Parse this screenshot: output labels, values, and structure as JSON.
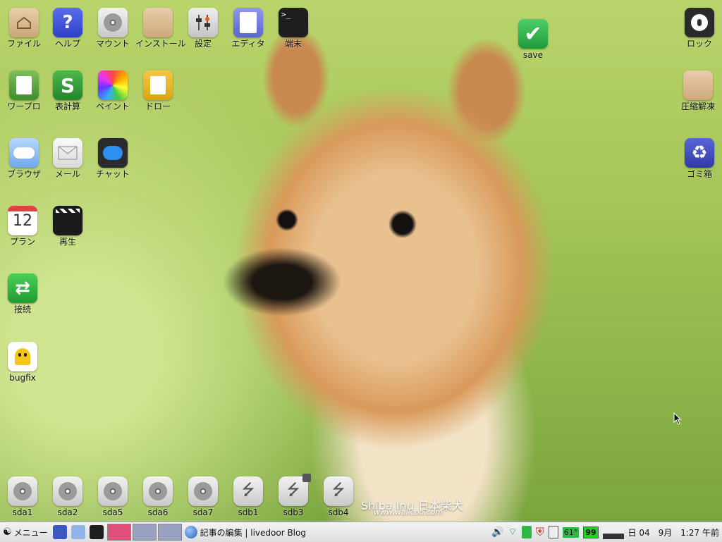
{
  "desktop": {
    "icons": {
      "file": "ファイル",
      "help": "ヘルプ",
      "mount": "マウント",
      "install": "インストール",
      "settings": "設定",
      "editor": "エディタ",
      "terminal": "端末",
      "save": "save",
      "lock": "ロック",
      "wordpro": "ワープロ",
      "spreadsheet": "表計算",
      "paint": "ペイント",
      "draw": "ドロー",
      "unzip": "圧縮解凍",
      "browser": "ブラウザ",
      "mail": "メール",
      "chat": "チャット",
      "trash": "ゴミ箱",
      "plan": "プラン",
      "plan_day": "12",
      "play": "再生",
      "connect": "接続",
      "bugfix": "bugfix"
    },
    "drives": [
      "sda1",
      "sda2",
      "sda5",
      "sda6",
      "sda7",
      "sdb1",
      "sdb3",
      "sdb4"
    ],
    "watermark": {
      "title": "Shiba Inu",
      "jp": "日本柴犬",
      "url": "www.wallcoo.com"
    }
  },
  "taskbar": {
    "menu": "メニュー",
    "window_title": "記事の編集 | livedoor Blog",
    "temp": "61°",
    "battery": "99",
    "clock": "日 04　9月　1:27 午前"
  }
}
